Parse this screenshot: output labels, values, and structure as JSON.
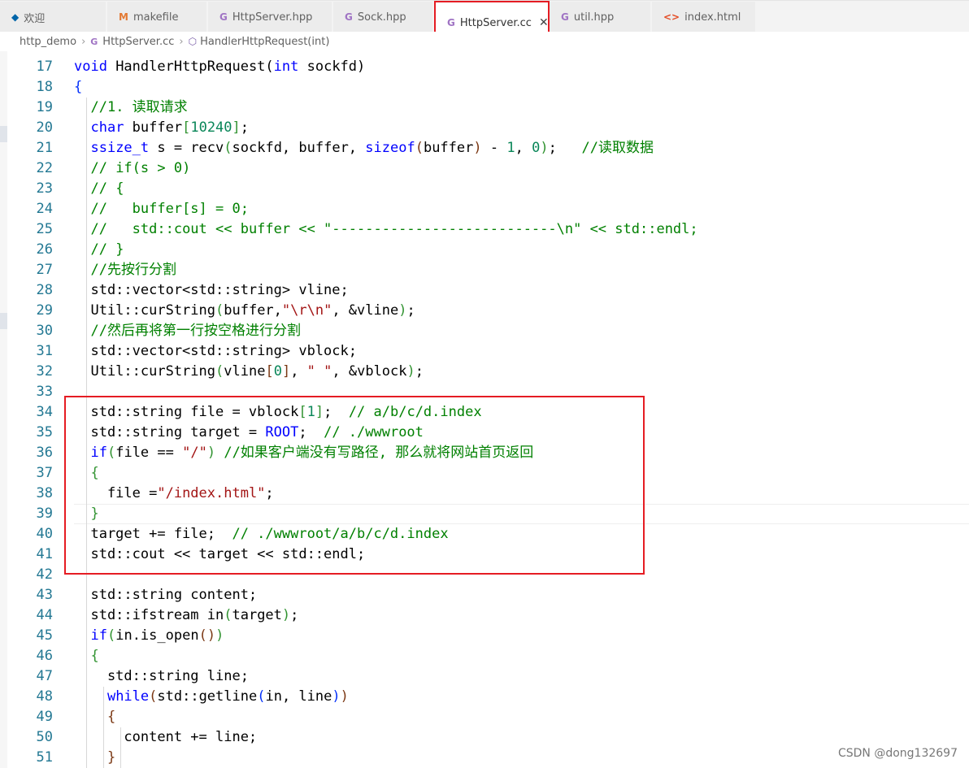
{
  "tabs": [
    {
      "label": "欢迎",
      "icon": "vscode-logo-icon",
      "glyph": "◆"
    },
    {
      "label": "makefile",
      "icon": "makefile-icon",
      "glyph": "M"
    },
    {
      "label": "HttpServer.hpp",
      "icon": "cpp-file-icon",
      "glyph": "G"
    },
    {
      "label": "Sock.hpp",
      "icon": "cpp-file-icon",
      "glyph": "G"
    },
    {
      "label": "HttpServer.cc",
      "icon": "cpp-file-icon",
      "glyph": "G",
      "active": true,
      "close": "✕"
    },
    {
      "label": "util.hpp",
      "icon": "cpp-file-icon",
      "glyph": "G"
    },
    {
      "label": "index.html",
      "icon": "html-file-icon",
      "glyph": "<>"
    }
  ],
  "breadcrumb": {
    "folder": "http_demo",
    "file": "HttpServer.cc",
    "symbol": "HandlerHttpRequest(int)",
    "sep": "›"
  },
  "editor": {
    "lines": [
      {
        "n": "17",
        "tokens": [
          [
            "k",
            "void"
          ],
          [
            "p",
            " HandlerHttpRequest("
          ],
          [
            "k",
            "int"
          ],
          [
            "p",
            " sockfd)"
          ]
        ]
      },
      {
        "n": "18",
        "tokens": [
          [
            "b1",
            "{"
          ]
        ]
      },
      {
        "n": "19",
        "tokens": [
          [
            "p",
            "  "
          ],
          [
            "c",
            "//1. 读取请求"
          ]
        ]
      },
      {
        "n": "20",
        "tokens": [
          [
            "p",
            "  "
          ],
          [
            "k",
            "char"
          ],
          [
            "p",
            " buffer"
          ],
          [
            "b2",
            "["
          ],
          [
            "n",
            "10240"
          ],
          [
            "b2",
            "]"
          ],
          [
            "p",
            ";"
          ]
        ]
      },
      {
        "n": "21",
        "tokens": [
          [
            "p",
            "  "
          ],
          [
            "k",
            "ssize_t"
          ],
          [
            "p",
            " s = recv"
          ],
          [
            "b2",
            "("
          ],
          [
            "p",
            "sockfd, buffer, "
          ],
          [
            "k",
            "sizeof"
          ],
          [
            "b3",
            "("
          ],
          [
            "p",
            "buffer"
          ],
          [
            "b3",
            ")"
          ],
          [
            "p",
            " - "
          ],
          [
            "n",
            "1"
          ],
          [
            "p",
            ", "
          ],
          [
            "n",
            "0"
          ],
          [
            "b2",
            ")"
          ],
          [
            "p",
            ";   "
          ],
          [
            "c",
            "//读取数据"
          ]
        ]
      },
      {
        "n": "22",
        "tokens": [
          [
            "p",
            "  "
          ],
          [
            "c",
            "// if(s > 0)"
          ]
        ]
      },
      {
        "n": "23",
        "tokens": [
          [
            "p",
            "  "
          ],
          [
            "c",
            "// {"
          ]
        ]
      },
      {
        "n": "24",
        "tokens": [
          [
            "p",
            "  "
          ],
          [
            "c",
            "//   buffer[s] = 0;"
          ]
        ]
      },
      {
        "n": "25",
        "tokens": [
          [
            "p",
            "  "
          ],
          [
            "c",
            "//   std::cout << buffer << \"---------------------------\\n\" << std::endl;"
          ]
        ]
      },
      {
        "n": "26",
        "tokens": [
          [
            "p",
            "  "
          ],
          [
            "c",
            "// }"
          ]
        ]
      },
      {
        "n": "27",
        "tokens": [
          [
            "p",
            "  "
          ],
          [
            "c",
            "//先按行分割"
          ]
        ]
      },
      {
        "n": "28",
        "tokens": [
          [
            "p",
            "  std::vector<std::string> vline;"
          ]
        ]
      },
      {
        "n": "29",
        "tokens": [
          [
            "p",
            "  Util::curString"
          ],
          [
            "b2",
            "("
          ],
          [
            "p",
            "buffer,"
          ],
          [
            "s",
            "\"\\r\\n\""
          ],
          [
            "p",
            ", &vline"
          ],
          [
            "b2",
            ")"
          ],
          [
            "p",
            ";"
          ]
        ]
      },
      {
        "n": "30",
        "tokens": [
          [
            "p",
            "  "
          ],
          [
            "c",
            "//然后再将第一行按空格进行分割"
          ]
        ]
      },
      {
        "n": "31",
        "tokens": [
          [
            "p",
            "  std::vector<std::string> vblock;"
          ]
        ]
      },
      {
        "n": "32",
        "tokens": [
          [
            "p",
            "  Util::curString"
          ],
          [
            "b2",
            "("
          ],
          [
            "p",
            "vline"
          ],
          [
            "b3",
            "["
          ],
          [
            "n",
            "0"
          ],
          [
            "b3",
            "]"
          ],
          [
            "p",
            ", "
          ],
          [
            "s",
            "\" \""
          ],
          [
            "p",
            ", &vblock"
          ],
          [
            "b2",
            ")"
          ],
          [
            "p",
            ";"
          ]
        ]
      },
      {
        "n": "33",
        "tokens": []
      },
      {
        "n": "34",
        "tokens": [
          [
            "p",
            "  std::string file = vblock"
          ],
          [
            "b2",
            "["
          ],
          [
            "n",
            "1"
          ],
          [
            "b2",
            "]"
          ],
          [
            "p",
            ";  "
          ],
          [
            "c",
            "// a/b/c/d.index"
          ]
        ]
      },
      {
        "n": "35",
        "tokens": [
          [
            "p",
            "  std::string target = "
          ],
          [
            "k",
            "ROOT"
          ],
          [
            "p",
            ";  "
          ],
          [
            "c",
            "// ./wwwroot"
          ]
        ]
      },
      {
        "n": "36",
        "tokens": [
          [
            "p",
            "  "
          ],
          [
            "k",
            "if"
          ],
          [
            "b2",
            "("
          ],
          [
            "p",
            "file == "
          ],
          [
            "s",
            "\"/\""
          ],
          [
            "b2",
            ")"
          ],
          [
            "p",
            " "
          ],
          [
            "c",
            "//如果客户端没有写路径, 那么就将网站首页返回"
          ]
        ]
      },
      {
        "n": "37",
        "tokens": [
          [
            "p",
            "  "
          ],
          [
            "b2",
            "{"
          ]
        ]
      },
      {
        "n": "38",
        "tokens": [
          [
            "p",
            "    file ="
          ],
          [
            "s",
            "\"/index.html\""
          ],
          [
            "p",
            ";"
          ]
        ]
      },
      {
        "n": "39",
        "tokens": [
          [
            "p",
            "  "
          ],
          [
            "b2",
            "}"
          ]
        ]
      },
      {
        "n": "40",
        "tokens": [
          [
            "p",
            "  target += file;  "
          ],
          [
            "c",
            "// ./wwwroot/a/b/c/d.index"
          ]
        ]
      },
      {
        "n": "41",
        "tokens": [
          [
            "p",
            "  std::cout << target << std::endl;"
          ]
        ]
      },
      {
        "n": "42",
        "tokens": []
      },
      {
        "n": "43",
        "tokens": [
          [
            "p",
            "  std::string content;"
          ]
        ]
      },
      {
        "n": "44",
        "tokens": [
          [
            "p",
            "  std::ifstream in"
          ],
          [
            "b2",
            "("
          ],
          [
            "p",
            "target"
          ],
          [
            "b2",
            ")"
          ],
          [
            "p",
            ";"
          ]
        ]
      },
      {
        "n": "45",
        "tokens": [
          [
            "p",
            "  "
          ],
          [
            "k",
            "if"
          ],
          [
            "b2",
            "("
          ],
          [
            "p",
            "in.is_open"
          ],
          [
            "b3",
            "()"
          ],
          [
            "b2",
            ")"
          ]
        ]
      },
      {
        "n": "46",
        "tokens": [
          [
            "p",
            "  "
          ],
          [
            "b2",
            "{"
          ]
        ]
      },
      {
        "n": "47",
        "tokens": [
          [
            "p",
            "    std::string line;"
          ]
        ]
      },
      {
        "n": "48",
        "tokens": [
          [
            "p",
            "    "
          ],
          [
            "k",
            "while"
          ],
          [
            "b3",
            "("
          ],
          [
            "p",
            "std::getline"
          ],
          [
            "b1",
            "("
          ],
          [
            "p",
            "in, line"
          ],
          [
            "b1",
            ")"
          ],
          [
            "b3",
            ")"
          ]
        ]
      },
      {
        "n": "49",
        "tokens": [
          [
            "p",
            "    "
          ],
          [
            "b3",
            "{"
          ]
        ]
      },
      {
        "n": "50",
        "tokens": [
          [
            "p",
            "      content += line;"
          ]
        ]
      },
      {
        "n": "51",
        "tokens": [
          [
            "p",
            "    "
          ],
          [
            "b3",
            "}"
          ]
        ]
      }
    ]
  },
  "watermark": "CSDN @dong132697",
  "colors": {
    "highlight_box": "#e51c23",
    "line_number": "#237893",
    "keyword": "#0000ff",
    "comment": "#008000",
    "string": "#a31515",
    "number": "#098658"
  }
}
